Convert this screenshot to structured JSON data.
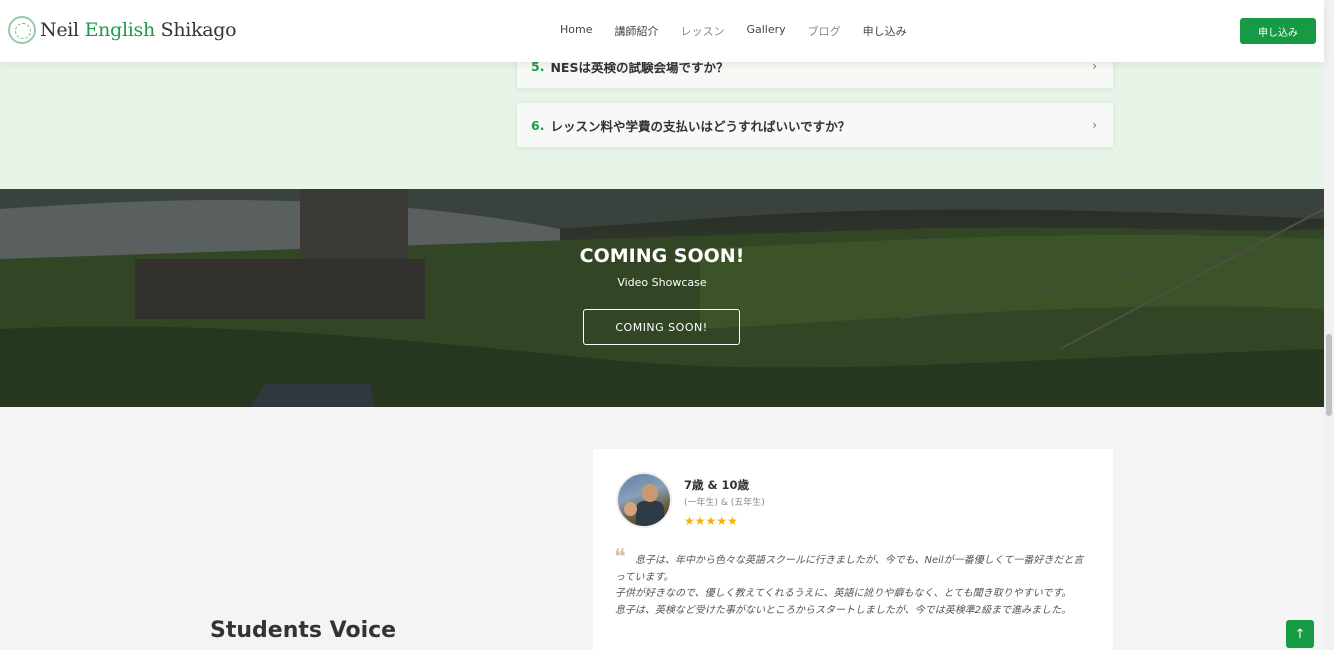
{
  "header": {
    "logo": {
      "part1": "Neil",
      "part2": "English",
      "part3": "Shikago"
    },
    "nav": [
      "Home",
      "講師紹介",
      "レッスン",
      "Gallery",
      "ブログ",
      "申し込み"
    ],
    "cta_label": "申し込み"
  },
  "faq": {
    "items": [
      {
        "num": "5.",
        "question": "NESは英検の試験会場ですか？"
      },
      {
        "num": "6.",
        "question": "レッスン料や学費の支払いはどうすればいいですか？"
      }
    ],
    "chevron": "›"
  },
  "hero": {
    "title": "COMING SOON!",
    "subtitle": "Video Showcase",
    "button_label": "COMING SOON!"
  },
  "students_voice": {
    "heading": "Students Voice",
    "card": {
      "name": "7歳 & 10歳",
      "grade": "(一年生) & (五年生)",
      "stars": "★★★★★",
      "quote_mark": "❝",
      "lines": [
        "息子は、年中から色々な英語スクールに行きましたが、今でも、Neilが一番優しくて一番好きだと言っています。",
        "子供が好きなので、優しく教えてくれるうえに、英語に訛りや癖もなく、とても聞き取りやすいです。",
        "息子は、英検など受けた事がないところからスタートしましたが、今では英検準2級まで進みました。"
      ]
    }
  },
  "scroll_top_icon": "↑",
  "colors": {
    "accent": "#169b44",
    "faq_bg": "#e8f4e7",
    "star": "#f5b400"
  }
}
